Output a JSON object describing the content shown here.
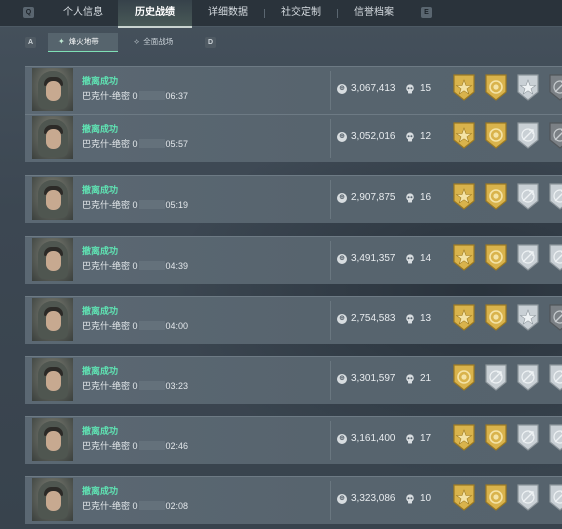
{
  "nav": {
    "left_key": "Q",
    "right_key": "E",
    "tabs": [
      "个人信息",
      "历史战绩",
      "详细数据",
      "社交定制",
      "信誉档案"
    ],
    "active_index": 1
  },
  "subnav": {
    "left_key": "A",
    "right_key": "D",
    "tabs": [
      "烽火地带",
      "全面战场"
    ],
    "active_index": 0
  },
  "icons": {
    "currency": "coin-icon",
    "kills": "skull-icon",
    "badge_gold": "gold-shield-badge",
    "badge_silver": "silver-shield-badge"
  },
  "colors": {
    "status_text": "#5fe3b3",
    "badge_gold": "#c9a23a",
    "badge_silver": "#b8c0c6",
    "badge_dark": "#6f7479"
  },
  "records": [
    {
      "status": "撤离成功",
      "map": "巴克什-绝密",
      "date_prefix": "0",
      "time": "06:37",
      "value": "3,067,413",
      "kills": "15",
      "badges": [
        "gold-star",
        "gold-medal",
        "silver-star",
        "dark-plane"
      ]
    },
    {
      "status": "撤离成功",
      "map": "巴克什-绝密",
      "date_prefix": "0",
      "time": "05:57",
      "value": "3,052,016",
      "kills": "12",
      "badges": [
        "gold-star",
        "gold-medal",
        "silver-plane",
        "dark-plane"
      ]
    },
    {
      "status": "撤离成功",
      "map": "巴克什-绝密",
      "date_prefix": "0",
      "time": "05:19",
      "value": "2,907,875",
      "kills": "16",
      "badges": [
        "gold-star",
        "gold-medal",
        "silver-plane",
        "silver-plane"
      ]
    },
    {
      "status": "撤离成功",
      "map": "巴克什-绝密",
      "date_prefix": "0",
      "time": "04:39",
      "value": "3,491,357",
      "kills": "14",
      "badges": [
        "gold-star",
        "gold-medal",
        "silver-plane",
        "silver-plane"
      ]
    },
    {
      "status": "撤离成功",
      "map": "巴克什-绝密",
      "date_prefix": "0",
      "time": "04:00",
      "value": "2,754,583",
      "kills": "13",
      "badges": [
        "gold-star",
        "gold-medal",
        "silver-star",
        "dark-plane"
      ]
    },
    {
      "status": "撤离成功",
      "map": "巴克什-绝密",
      "date_prefix": "0",
      "time": "03:23",
      "value": "3,301,597",
      "kills": "21",
      "badges": [
        "gold-medal",
        "silver-plane",
        "silver-plane",
        "silver-plane"
      ]
    },
    {
      "status": "撤离成功",
      "map": "巴克什-绝密",
      "date_prefix": "0",
      "time": "02:46",
      "value": "3,161,400",
      "kills": "17",
      "badges": [
        "gold-star",
        "gold-medal",
        "silver-plane",
        "silver-plane"
      ]
    },
    {
      "status": "撤离成功",
      "map": "巴克什-绝密",
      "date_prefix": "0",
      "time": "02:08",
      "value": "3,323,086",
      "kills": "10",
      "badges": [
        "gold-star",
        "gold-medal",
        "silver-plane",
        "silver-plane"
      ]
    }
  ]
}
